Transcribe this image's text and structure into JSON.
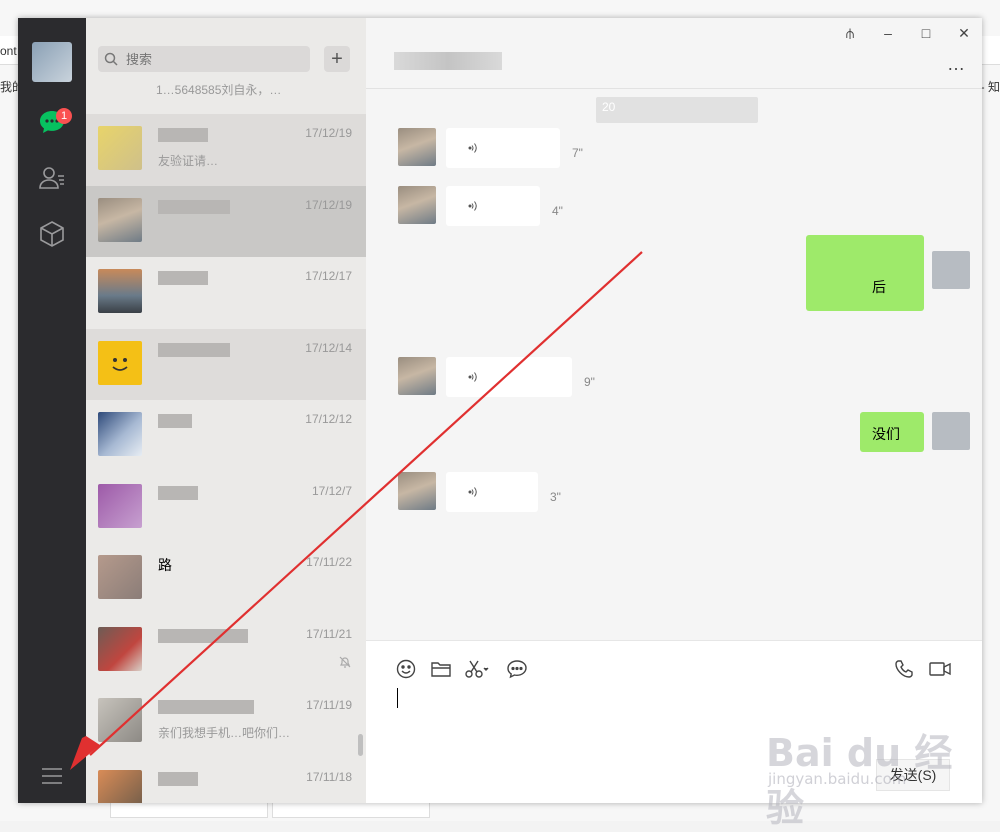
{
  "background": {
    "left_text": "ont",
    "bookmark_left": "我的",
    "bookmark_right": "- 知"
  },
  "sidebar": {
    "unread_badge": "1",
    "icons": [
      "chat-icon",
      "contacts-icon",
      "favorites-icon",
      "menu-icon"
    ]
  },
  "search": {
    "placeholder": "搜索",
    "add_label": "+"
  },
  "chat_list": {
    "top_snippet": "1…5648585刘自永，…",
    "items": [
      {
        "time": "17/12/19",
        "message": "友验证请…"
      },
      {
        "time": "17/12/19",
        "message": ""
      },
      {
        "time": "17/12/17",
        "message": ""
      },
      {
        "time": "17/12/14",
        "message": ""
      },
      {
        "time": "17/12/12",
        "message": ""
      },
      {
        "time": "17/12/7",
        "message": ""
      },
      {
        "name": "路",
        "time": "17/11/22",
        "message": ""
      },
      {
        "time": "17/11/21",
        "message": ""
      },
      {
        "time": "17/11/19",
        "message": "亲们我想手机…吧你们…"
      },
      {
        "time": "17/11/18",
        "message": ""
      }
    ]
  },
  "chat": {
    "date_label": "20",
    "voice_messages": [
      {
        "duration": "7\""
      },
      {
        "duration": "4\""
      },
      {
        "duration": "9\""
      },
      {
        "duration": "3\""
      }
    ],
    "self_messages": [
      {
        "text": "后"
      },
      {
        "text": "没们"
      }
    ]
  },
  "composer": {
    "send_label": "发送(S)"
  },
  "window_controls": {
    "pin": "⫛",
    "minimize": "–",
    "maximize": "□",
    "close": "✕",
    "more": "…"
  },
  "watermark": {
    "logo": "Bai du 经验",
    "url": "jingyan.baidu.com"
  },
  "colors": {
    "sidebar": "#2b2b2e",
    "list_bg": "#ebeae8",
    "self_bubble": "#9eea6a",
    "badge": "#fa5151",
    "arrow": "#e03030"
  }
}
